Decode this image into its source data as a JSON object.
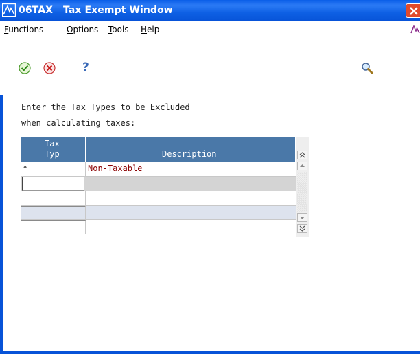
{
  "window": {
    "title": "06TAX   Tax Exempt Window"
  },
  "menu": [
    {
      "label": "Functions",
      "mnemonic": "F",
      "rest": "unctions"
    },
    {
      "label": "Options",
      "mnemonic": "O",
      "rest": "ptions"
    },
    {
      "label": "Tools",
      "mnemonic": "T",
      "rest": "ools"
    },
    {
      "label": "Help",
      "mnemonic": "H",
      "rest": "elp"
    }
  ],
  "toolbar": {
    "ok": "ok-icon",
    "cancel": "cancel-icon",
    "help": "?",
    "find": "search-icon"
  },
  "prompt": {
    "line1": "Enter the Tax Types to be Excluded",
    "line2": "when calculating taxes:"
  },
  "grid": {
    "columns": [
      {
        "line1": "Tax",
        "line2": "Typ"
      },
      {
        "line1": "",
        "line2": "Description"
      }
    ],
    "rows": [
      {
        "tax_typ": "*",
        "description": "Non-Taxable"
      },
      {
        "tax_typ": "",
        "description": ""
      },
      {
        "tax_typ": "",
        "description": ""
      },
      {
        "tax_typ": "",
        "description": ""
      },
      {
        "tax_typ": "",
        "description": ""
      }
    ]
  },
  "colors": {
    "title_bar": "#0753d8",
    "grid_header": "#4a78a8",
    "description_text": "#8b0000"
  }
}
